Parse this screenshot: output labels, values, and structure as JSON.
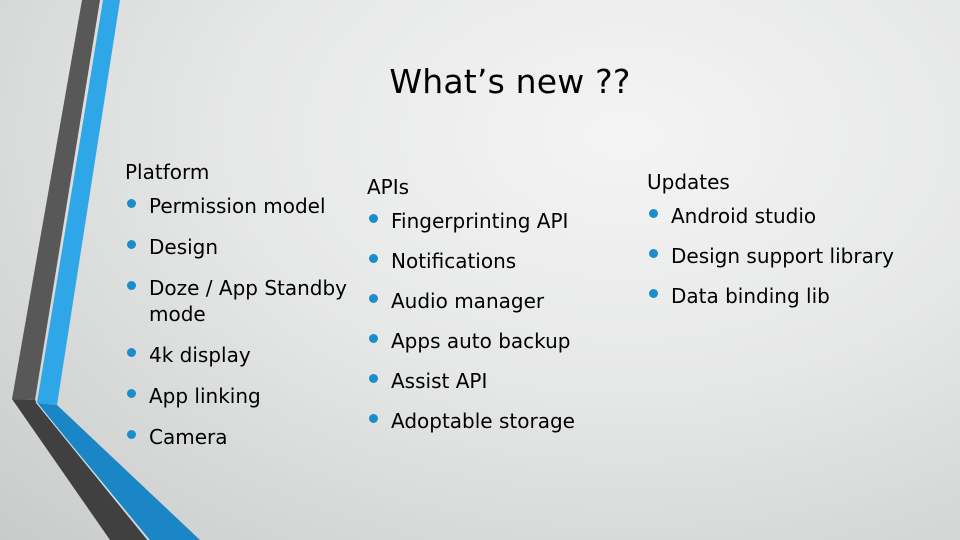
{
  "slide": {
    "title": "What’s new ??",
    "accent_color": "#29a3e6",
    "accent_dark_color": "#1b87c6",
    "bar_color": "#545454",
    "columns": [
      {
        "heading": "Platform",
        "items": [
          "Permission model",
          "Design",
          "Doze / App Standby mode",
          "4k display",
          "App linking",
          "Camera"
        ]
      },
      {
        "heading": "APIs",
        "items": [
          "Fingerprinting API",
          "Notifications",
          "Audio manager",
          "Apps auto backup",
          "Assist API",
          "Adoptable storage"
        ]
      },
      {
        "heading": "Updates",
        "items": [
          "Android studio",
          "Design support library",
          "Data binding lib"
        ]
      }
    ]
  }
}
